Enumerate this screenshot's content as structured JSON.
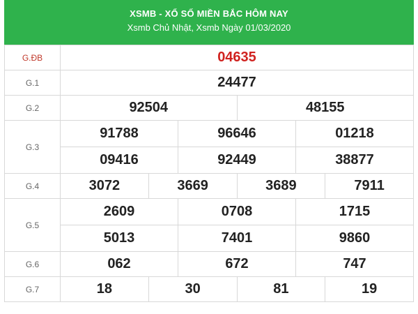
{
  "header": {
    "title": "XSMB - XỔ SỐ MIỀN BẮC HÔM NAY",
    "subtitle": "Xsmb Chủ Nhật, Xsmb Ngày 01/03/2020"
  },
  "prizes": {
    "gdb": {
      "label": "G.ĐB",
      "numbers": [
        "04635"
      ]
    },
    "g1": {
      "label": "G.1",
      "numbers": [
        "24477"
      ]
    },
    "g2": {
      "label": "G.2",
      "numbers": [
        "92504",
        "48155"
      ]
    },
    "g3": {
      "label": "G.3",
      "numbers": [
        "91788",
        "96646",
        "01218",
        "09416",
        "92449",
        "38877"
      ]
    },
    "g4": {
      "label": "G.4",
      "numbers": [
        "3072",
        "3669",
        "3689",
        "7911"
      ]
    },
    "g5": {
      "label": "G.5",
      "numbers": [
        "2609",
        "0708",
        "1715",
        "5013",
        "7401",
        "9860"
      ]
    },
    "g6": {
      "label": "G.6",
      "numbers": [
        "062",
        "672",
        "747"
      ]
    },
    "g7": {
      "label": "G.7",
      "numbers": [
        "18",
        "30",
        "81",
        "19"
      ]
    }
  },
  "colors": {
    "header_bg": "#2fb24c",
    "special_number": "#d0221f"
  }
}
